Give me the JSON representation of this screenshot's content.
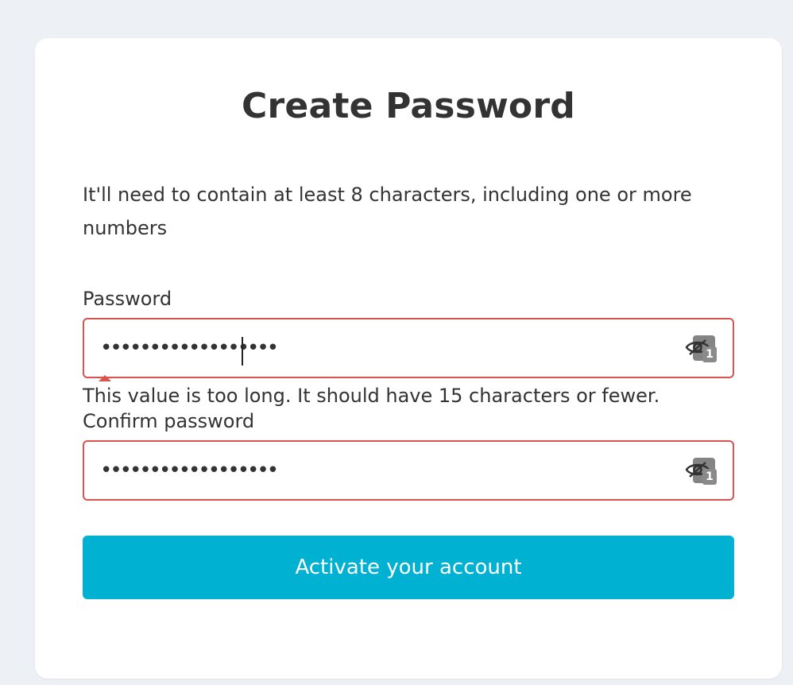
{
  "heading": "Create Password",
  "description": "It'll need to contain at least 8 characters, including one or more numbers",
  "password": {
    "label": "Password",
    "value": "••••••••••••••••••",
    "toggle_icon": "eye-icon",
    "badge_number": "1",
    "error": "This value is too long. It should have 15 characters or fewer."
  },
  "confirm_password": {
    "label": "Confirm password",
    "value": "••••••••••••••••••",
    "toggle_icon": "eye-icon",
    "badge_number": "1"
  },
  "submit_label": "Activate your account",
  "colors": {
    "background": "#edf1f5",
    "card": "#ffffff",
    "error_border": "#d9534f",
    "button": "#00b1d2",
    "text": "#333333"
  }
}
